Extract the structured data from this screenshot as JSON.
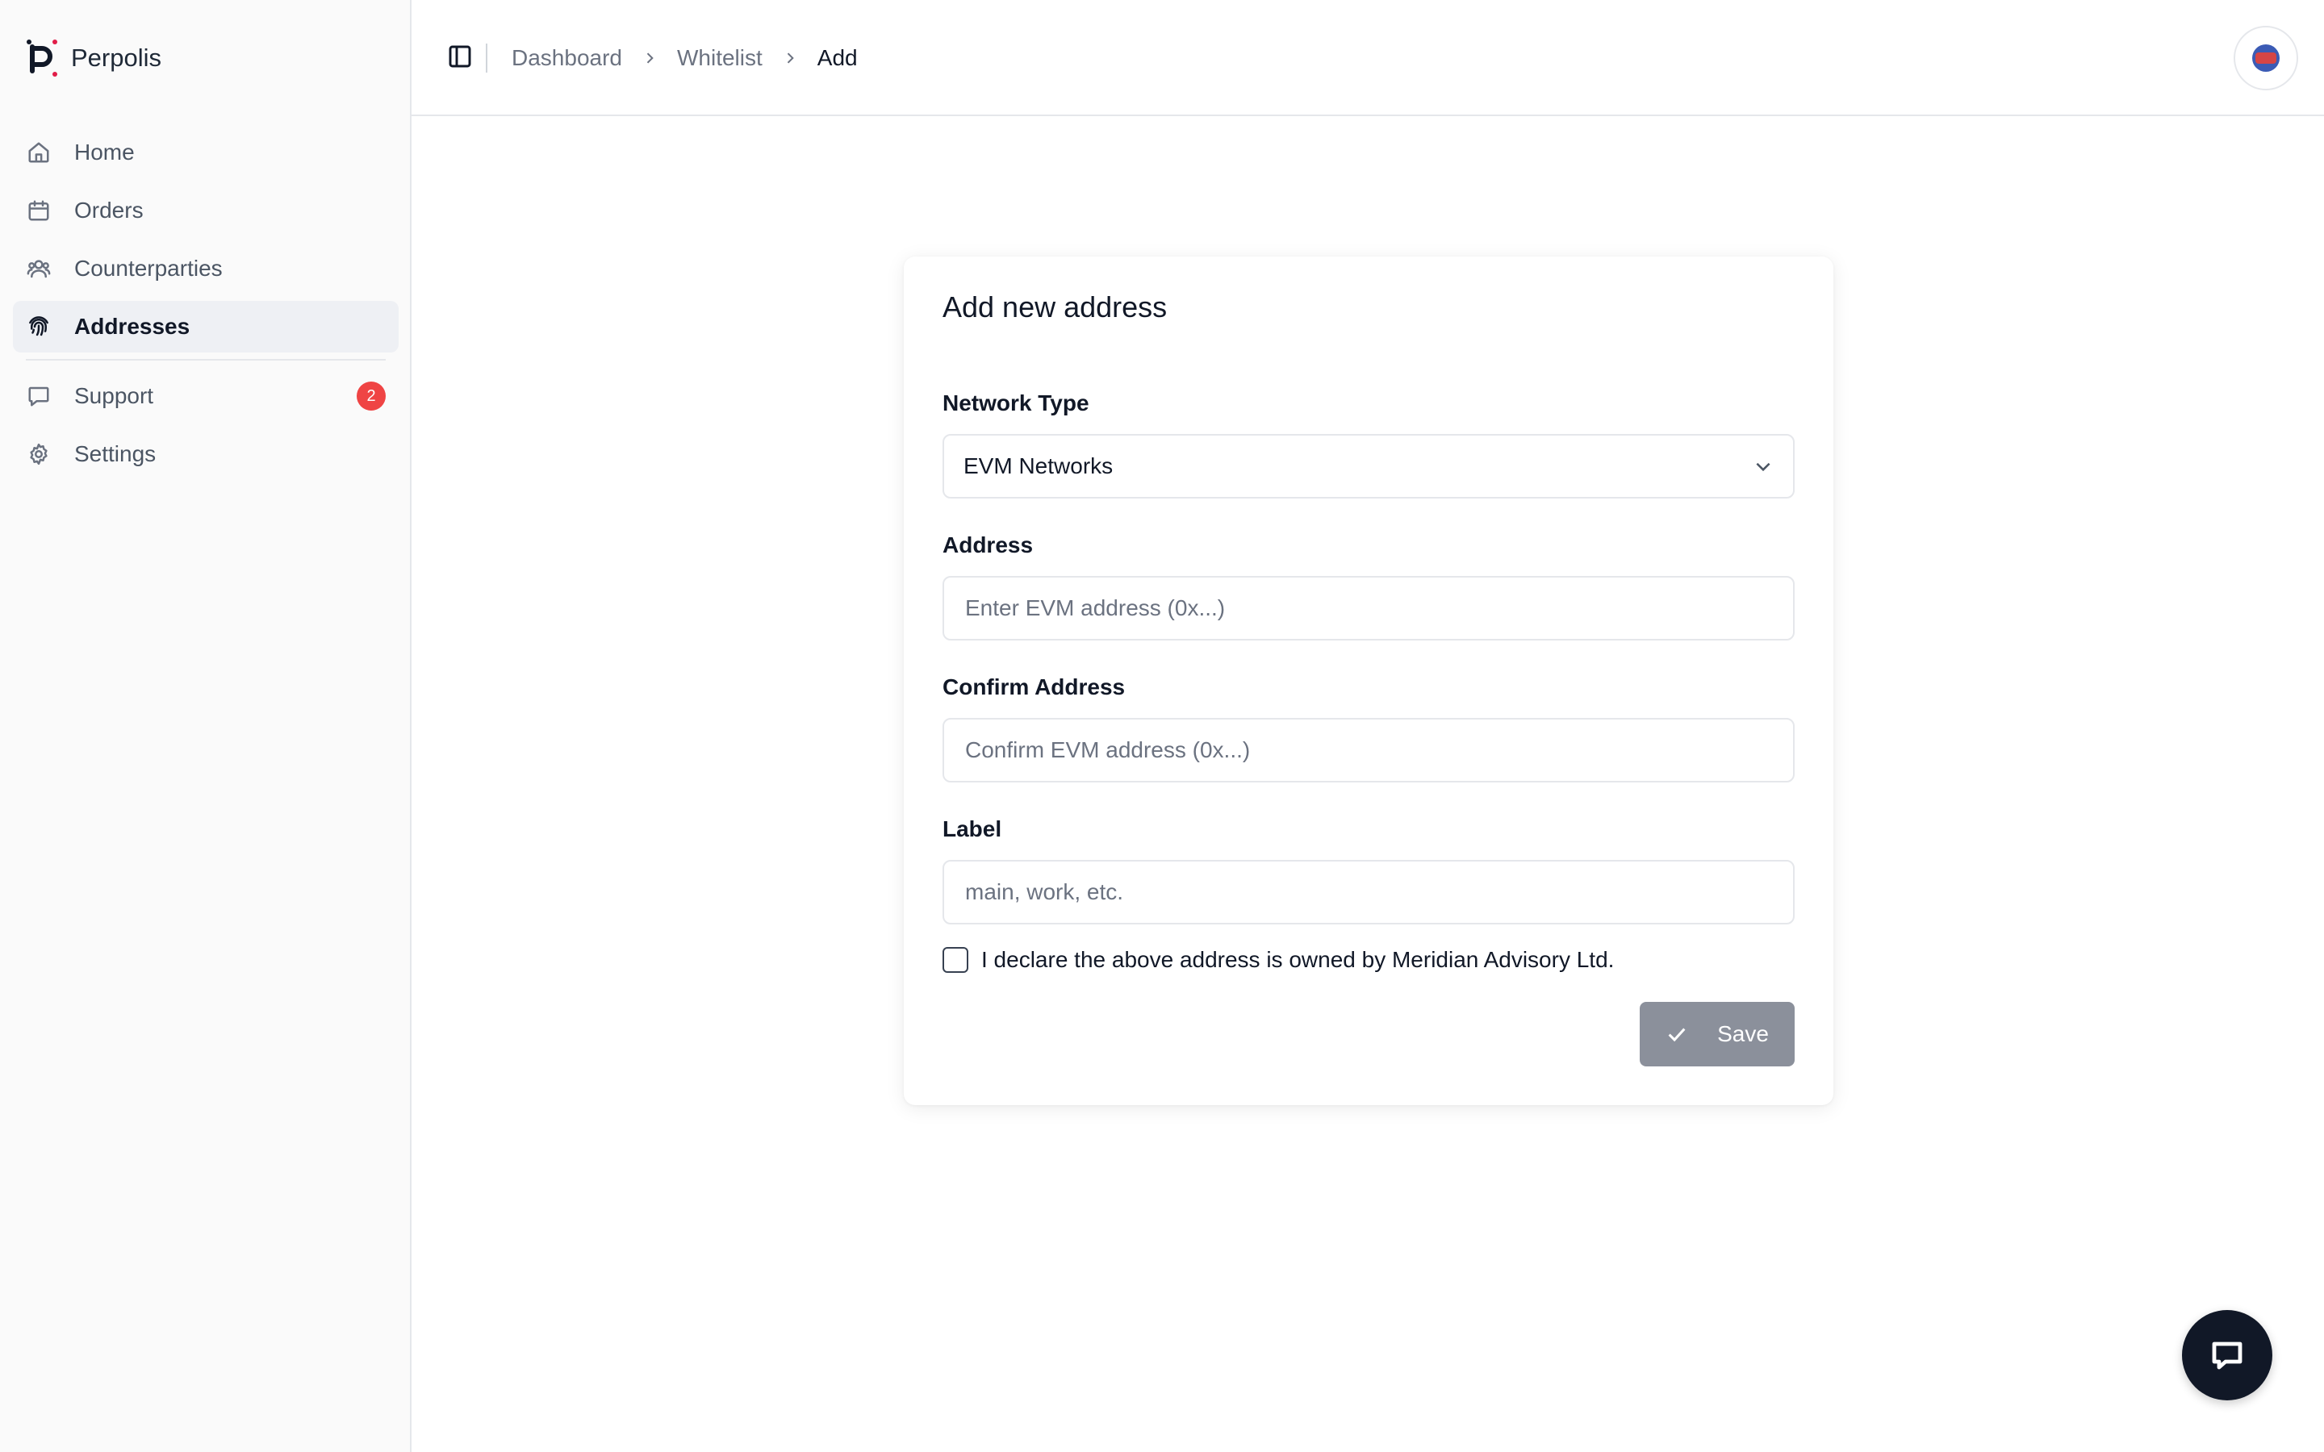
{
  "brand": {
    "name": "Perpolis"
  },
  "sidebar": {
    "items": [
      {
        "label": "Home",
        "icon": "home-icon"
      },
      {
        "label": "Orders",
        "icon": "calendar-icon"
      },
      {
        "label": "Counterparties",
        "icon": "users-icon"
      },
      {
        "label": "Addresses",
        "icon": "fingerprint-icon",
        "active": true
      },
      {
        "label": "Support",
        "icon": "message-icon",
        "badge": "2"
      },
      {
        "label": "Settings",
        "icon": "gear-icon"
      }
    ]
  },
  "header": {
    "breadcrumb": [
      "Dashboard",
      "Whitelist",
      "Add"
    ]
  },
  "form": {
    "title": "Add new address",
    "network_label": "Network Type",
    "network_value": "EVM Networks",
    "address_label": "Address",
    "address_placeholder": "Enter EVM address (0x...)",
    "confirm_label": "Confirm Address",
    "confirm_placeholder": "Confirm EVM address (0x...)",
    "label_label": "Label",
    "label_placeholder": "main, work, etc.",
    "declaration": "I declare the above address is owned by Meridian Advisory Ltd.",
    "save_label": "Save"
  },
  "colors": {
    "badge": "#ef4444",
    "save_button": "#8b909b",
    "chat_button": "#111827"
  }
}
